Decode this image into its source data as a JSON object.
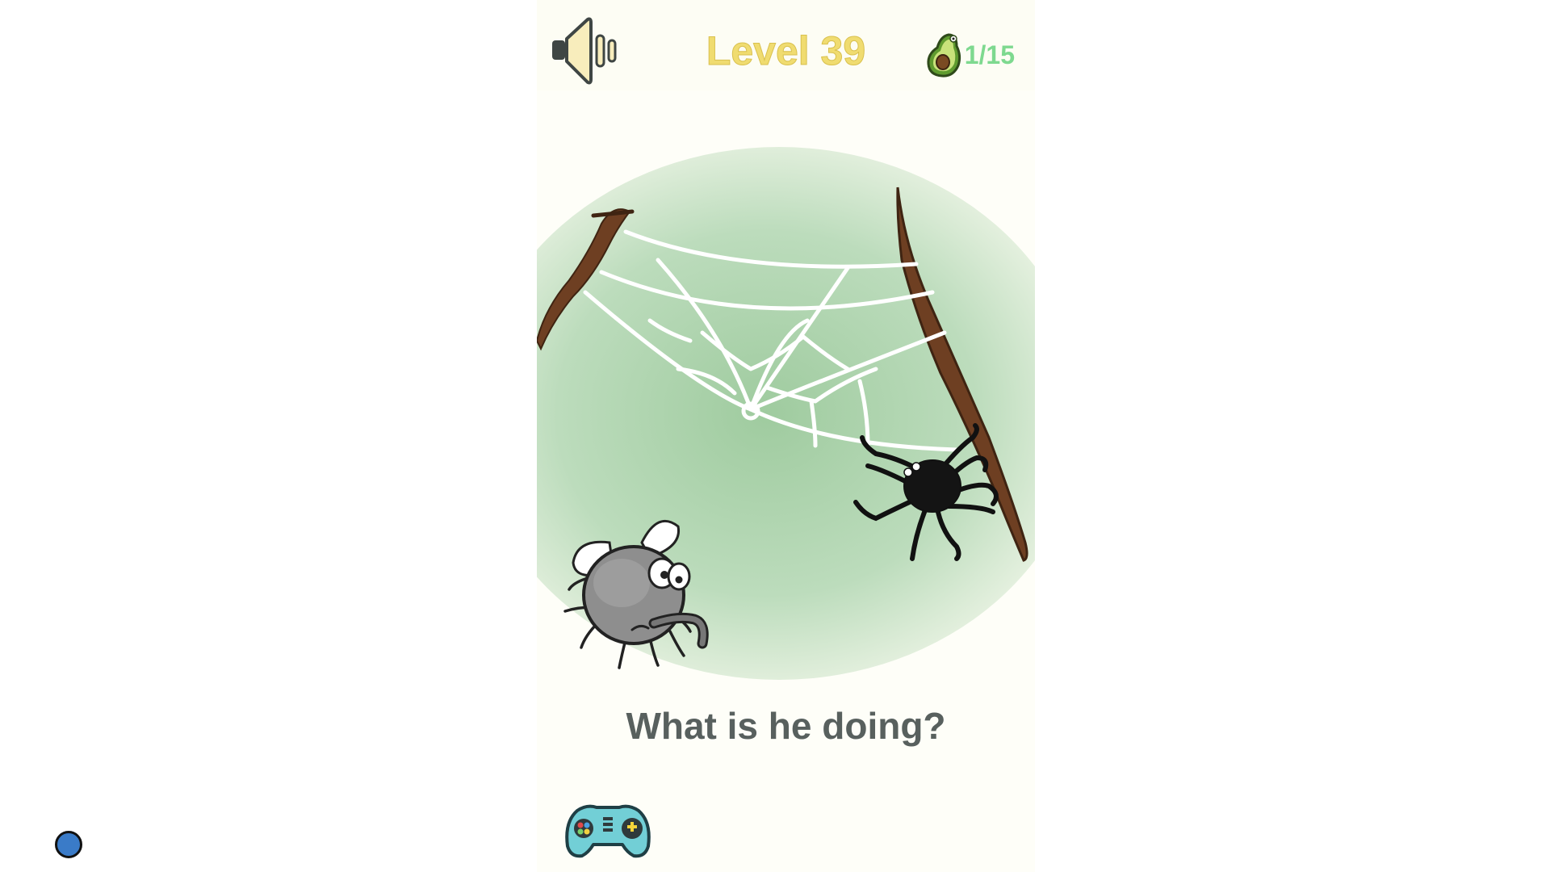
{
  "header": {
    "level_label": "Level 39",
    "progress_count": "1/15",
    "sound_icon": "speaker-icon",
    "progress_icon": "avocado-icon"
  },
  "question": "What is he doing?",
  "footer": {
    "gamepad_icon": "gamepad-icon",
    "floating_button_icon": "circle-dot"
  },
  "colors": {
    "level_text": "#f0dc70",
    "progress_text": "#7ed98f",
    "question_text": "#58605e",
    "scene_green": "#9fcb9f",
    "branch_brown": "#6e3f22",
    "floating_dot": "#3a7bc8"
  }
}
